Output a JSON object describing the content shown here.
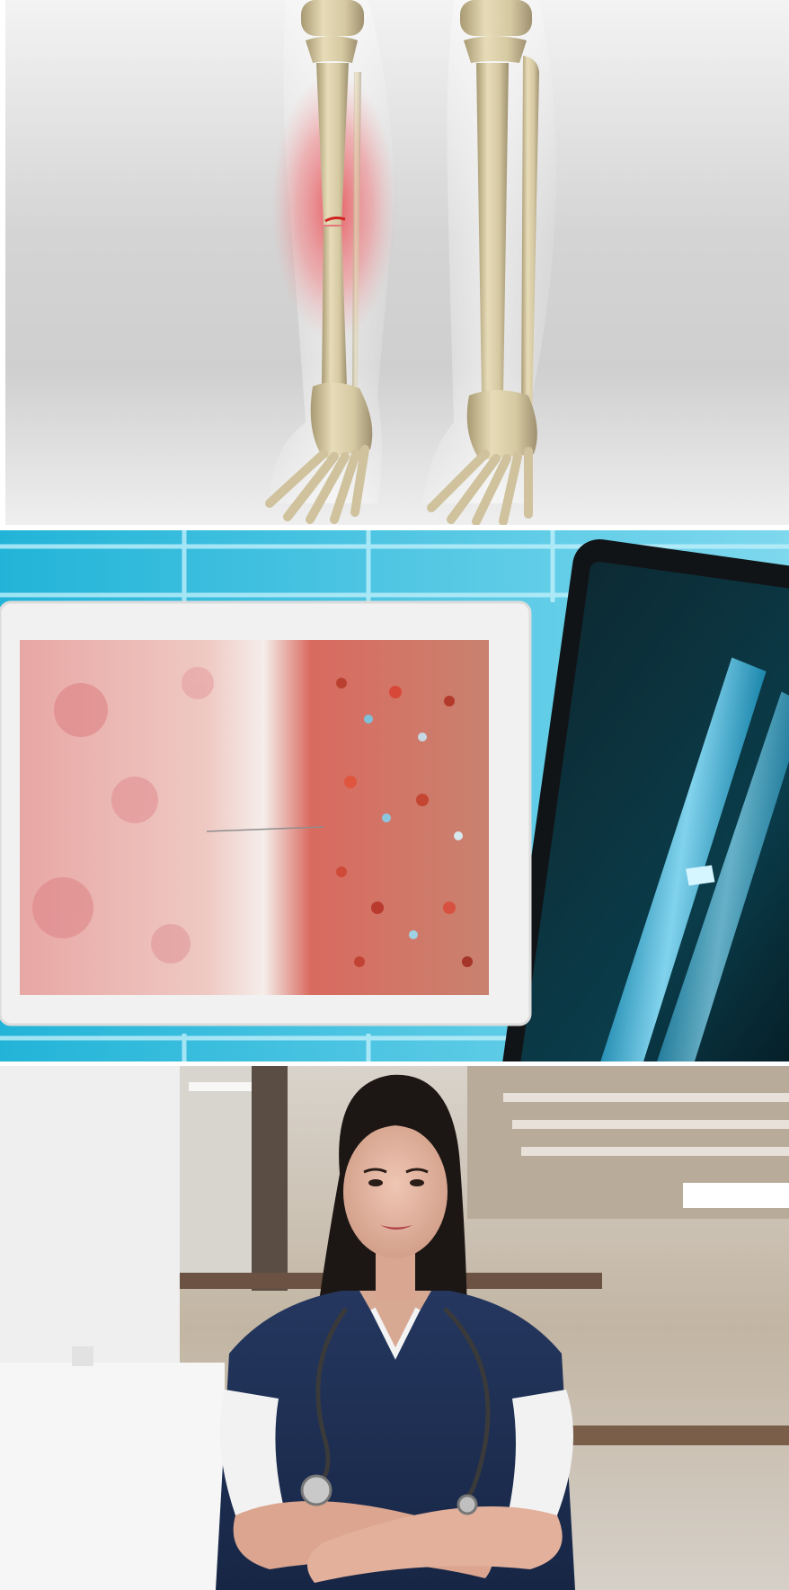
{
  "gallery": {
    "panels": [
      {
        "subject": "skeletal-leg-fracture",
        "palette": {
          "background": "#d9d9d9",
          "bone": "#d8cda9",
          "inflammation": "#e3545a"
        }
      },
      {
        "subject": "tissue-sample-and-xray",
        "palette": {
          "tiles": "#2fb6d8",
          "frame": "#eeeeee",
          "xray": "#66d2ff"
        }
      },
      {
        "subject": "healthcare-worker-portrait",
        "palette": {
          "scrubs": "#1f2f55",
          "hallway": "#c7b8a4",
          "skin": "#e2b49f"
        }
      }
    ]
  }
}
